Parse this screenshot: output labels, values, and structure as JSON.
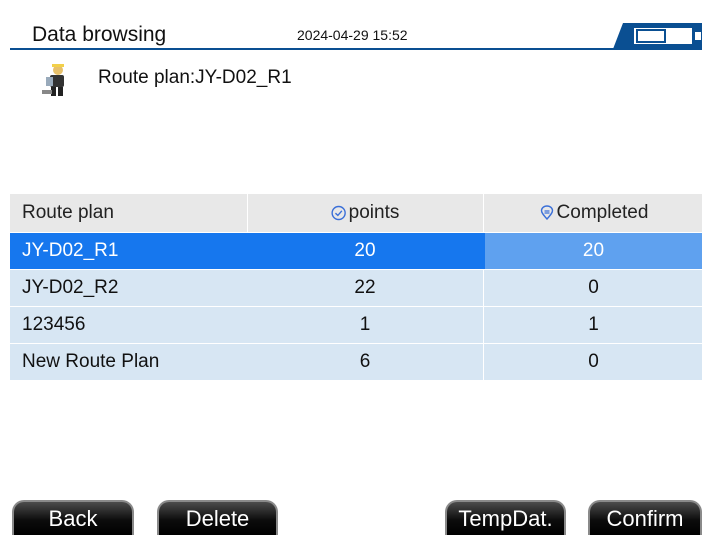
{
  "header": {
    "title": "Data browsing",
    "datetime": "2024-04-29 15:52",
    "toggle_icon": "battery-toggle-icon"
  },
  "route": {
    "text": "Route plan:JY-D02_R1",
    "icon": "worker-avatar-icon"
  },
  "table": {
    "columns": [
      "Route plan",
      "points",
      "Completed"
    ],
    "rows": [
      [
        "JY-D02_R1",
        "20",
        "20"
      ],
      [
        "JY-D02_R2",
        "22",
        "0"
      ],
      [
        "123456",
        "1",
        "1"
      ],
      [
        "New Route Plan",
        "6",
        "0"
      ]
    ],
    "selected_index": 0
  },
  "buttons": {
    "back": "Back",
    "delete": "Delete",
    "temp": "TempDat.",
    "confirm": "Confirm"
  },
  "colors": {
    "header_line": "#0a4f92",
    "selected_row": "#1677ee",
    "row_bg": "#d7e6f3",
    "header_row_bg": "#e8e8e8"
  }
}
